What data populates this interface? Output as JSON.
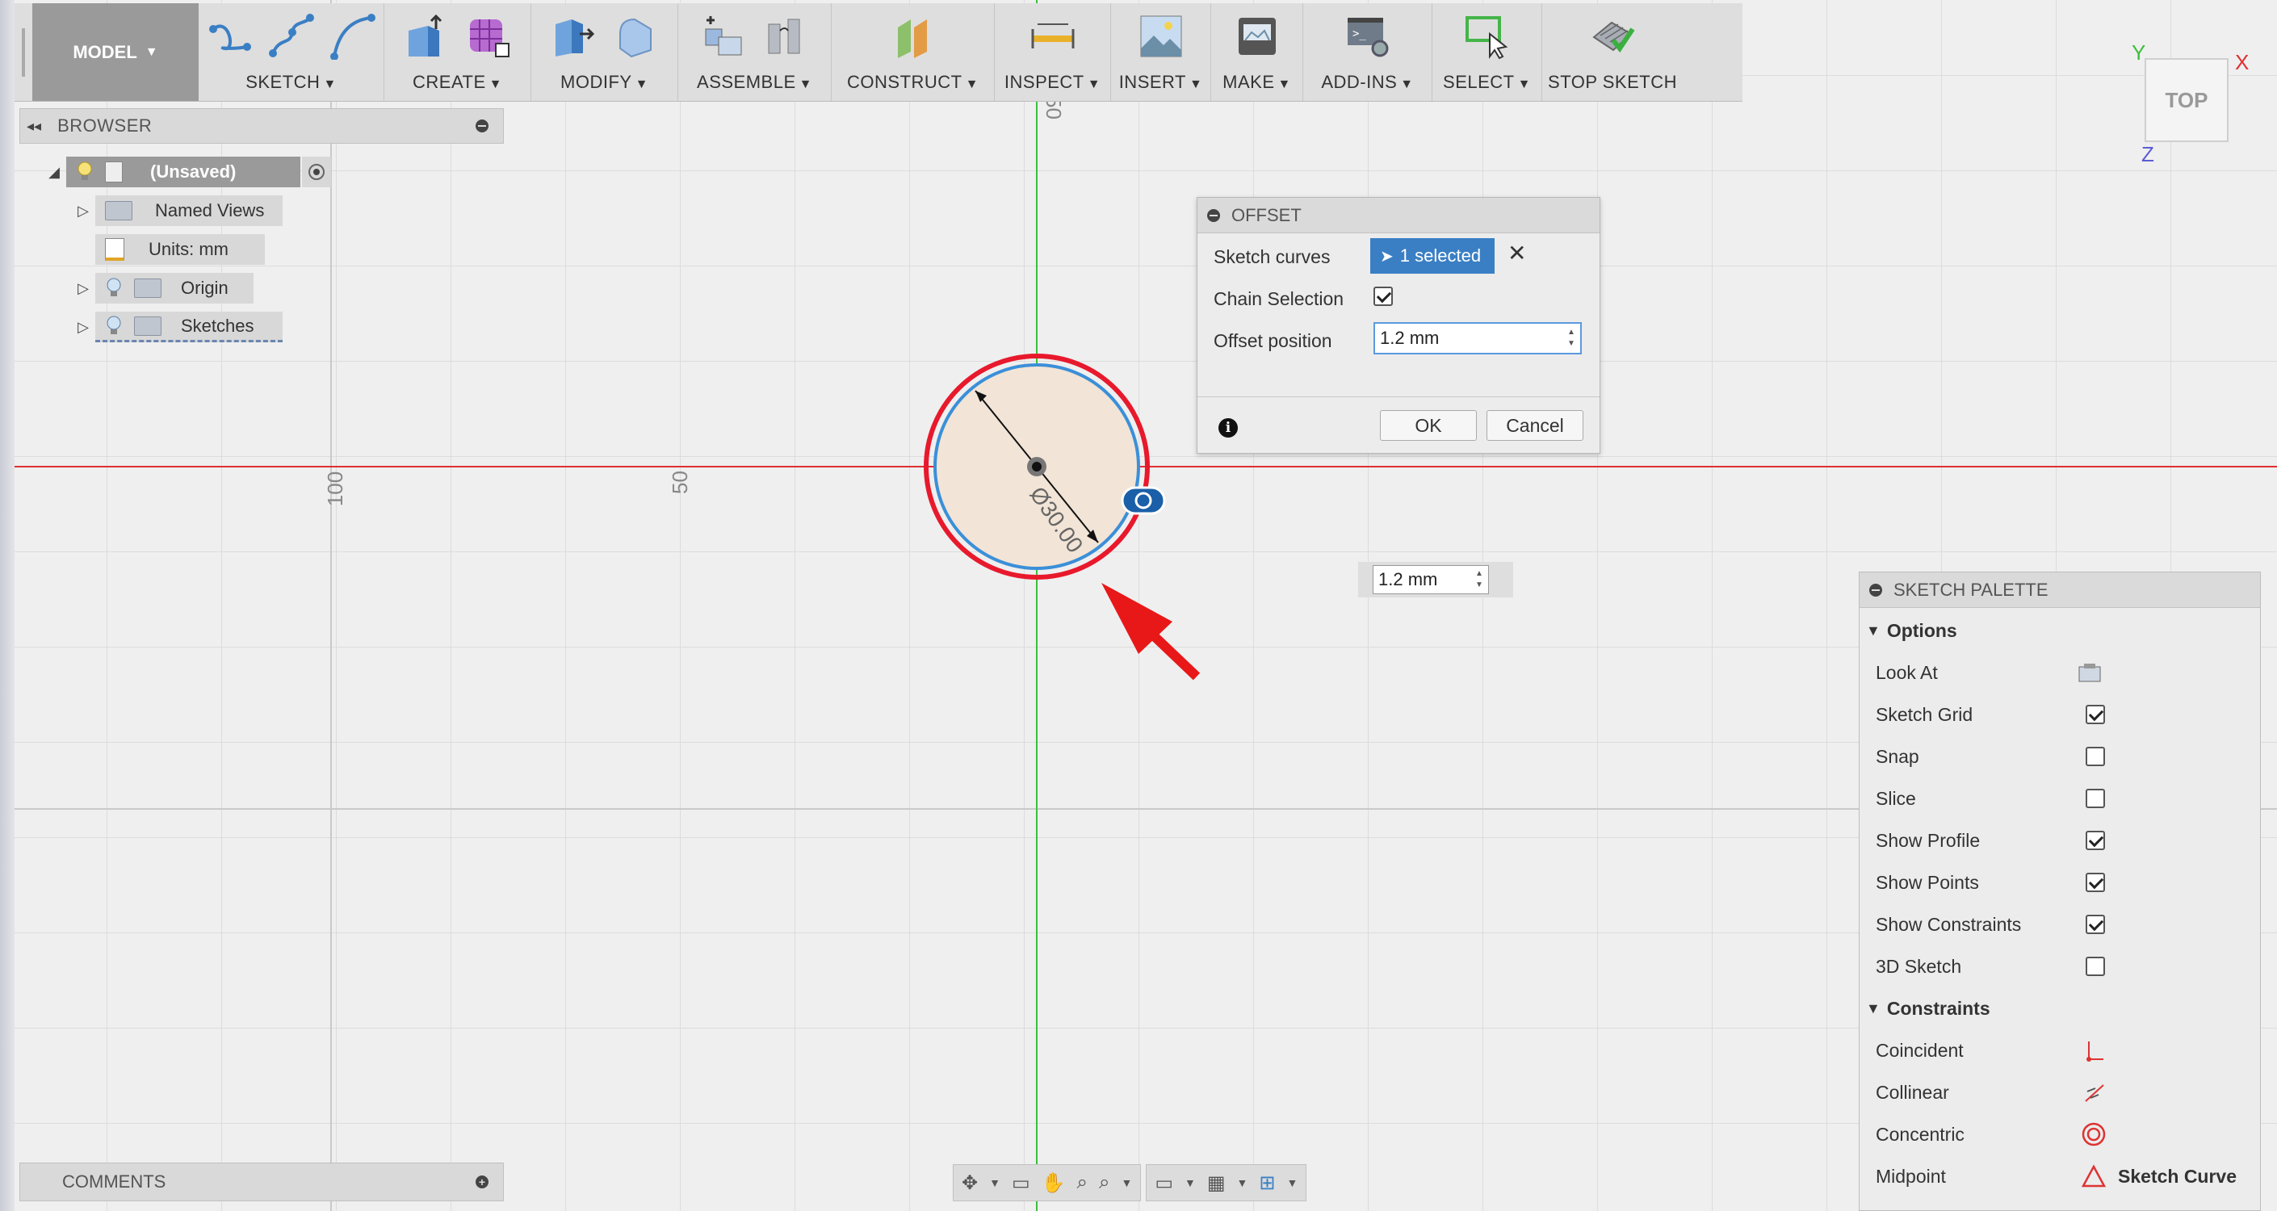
{
  "toolbar": {
    "model_label": "MODEL",
    "groups": [
      {
        "label": "SKETCH"
      },
      {
        "label": "CREATE"
      },
      {
        "label": "MODIFY"
      },
      {
        "label": "ASSEMBLE"
      },
      {
        "label": "CONSTRUCT"
      },
      {
        "label": "INSPECT"
      },
      {
        "label": "INSERT"
      },
      {
        "label": "MAKE"
      },
      {
        "label": "ADD-INS"
      },
      {
        "label": "SELECT"
      },
      {
        "label": "STOP SKETCH"
      }
    ]
  },
  "browser": {
    "title": "BROWSER",
    "items": [
      {
        "label": "(Unsaved)"
      },
      {
        "label": "Named Views"
      },
      {
        "label": "Units: mm"
      },
      {
        "label": "Origin"
      },
      {
        "label": "Sketches"
      }
    ]
  },
  "canvas": {
    "ruler_labels": [
      "50",
      "100",
      "50"
    ],
    "dimension_text": "Ø30.00",
    "floating_value": "1.2 mm",
    "viewcube_label": "TOP",
    "axis_x": "X",
    "axis_y": "Y",
    "axis_z": "Z",
    "colors": {
      "red_axis": "#e03030",
      "green_axis": "#3cbf3c",
      "offset_circle": "#e8192c",
      "base_circle": "#3b8fd8",
      "fill": "#f2e4d6"
    }
  },
  "offset_dialog": {
    "title": "OFFSET",
    "sketch_curves_label": "Sketch curves",
    "selection_text": "1 selected",
    "chain_selection_label": "Chain Selection",
    "chain_selection_checked": true,
    "offset_position_label": "Offset position",
    "offset_position_value": "1.2 mm",
    "ok_label": "OK",
    "cancel_label": "Cancel"
  },
  "sketch_palette": {
    "title": "SKETCH PALETTE",
    "options_header": "Options",
    "options": [
      {
        "label": "Look At",
        "control": "button"
      },
      {
        "label": "Sketch Grid",
        "checked": true
      },
      {
        "label": "Snap",
        "checked": false
      },
      {
        "label": "Slice",
        "checked": false
      },
      {
        "label": "Show Profile",
        "checked": true
      },
      {
        "label": "Show Points",
        "checked": true
      },
      {
        "label": "Show Constraints",
        "checked": true
      },
      {
        "label": "3D Sketch",
        "checked": false
      }
    ],
    "constraints_header": "Constraints",
    "constraints": [
      {
        "label": "Coincident"
      },
      {
        "label": "Collinear"
      },
      {
        "label": "Concentric"
      },
      {
        "label": "Midpoint"
      }
    ],
    "tooltip_label": "Sketch Curve"
  },
  "comments": {
    "title": "COMMENTS"
  }
}
